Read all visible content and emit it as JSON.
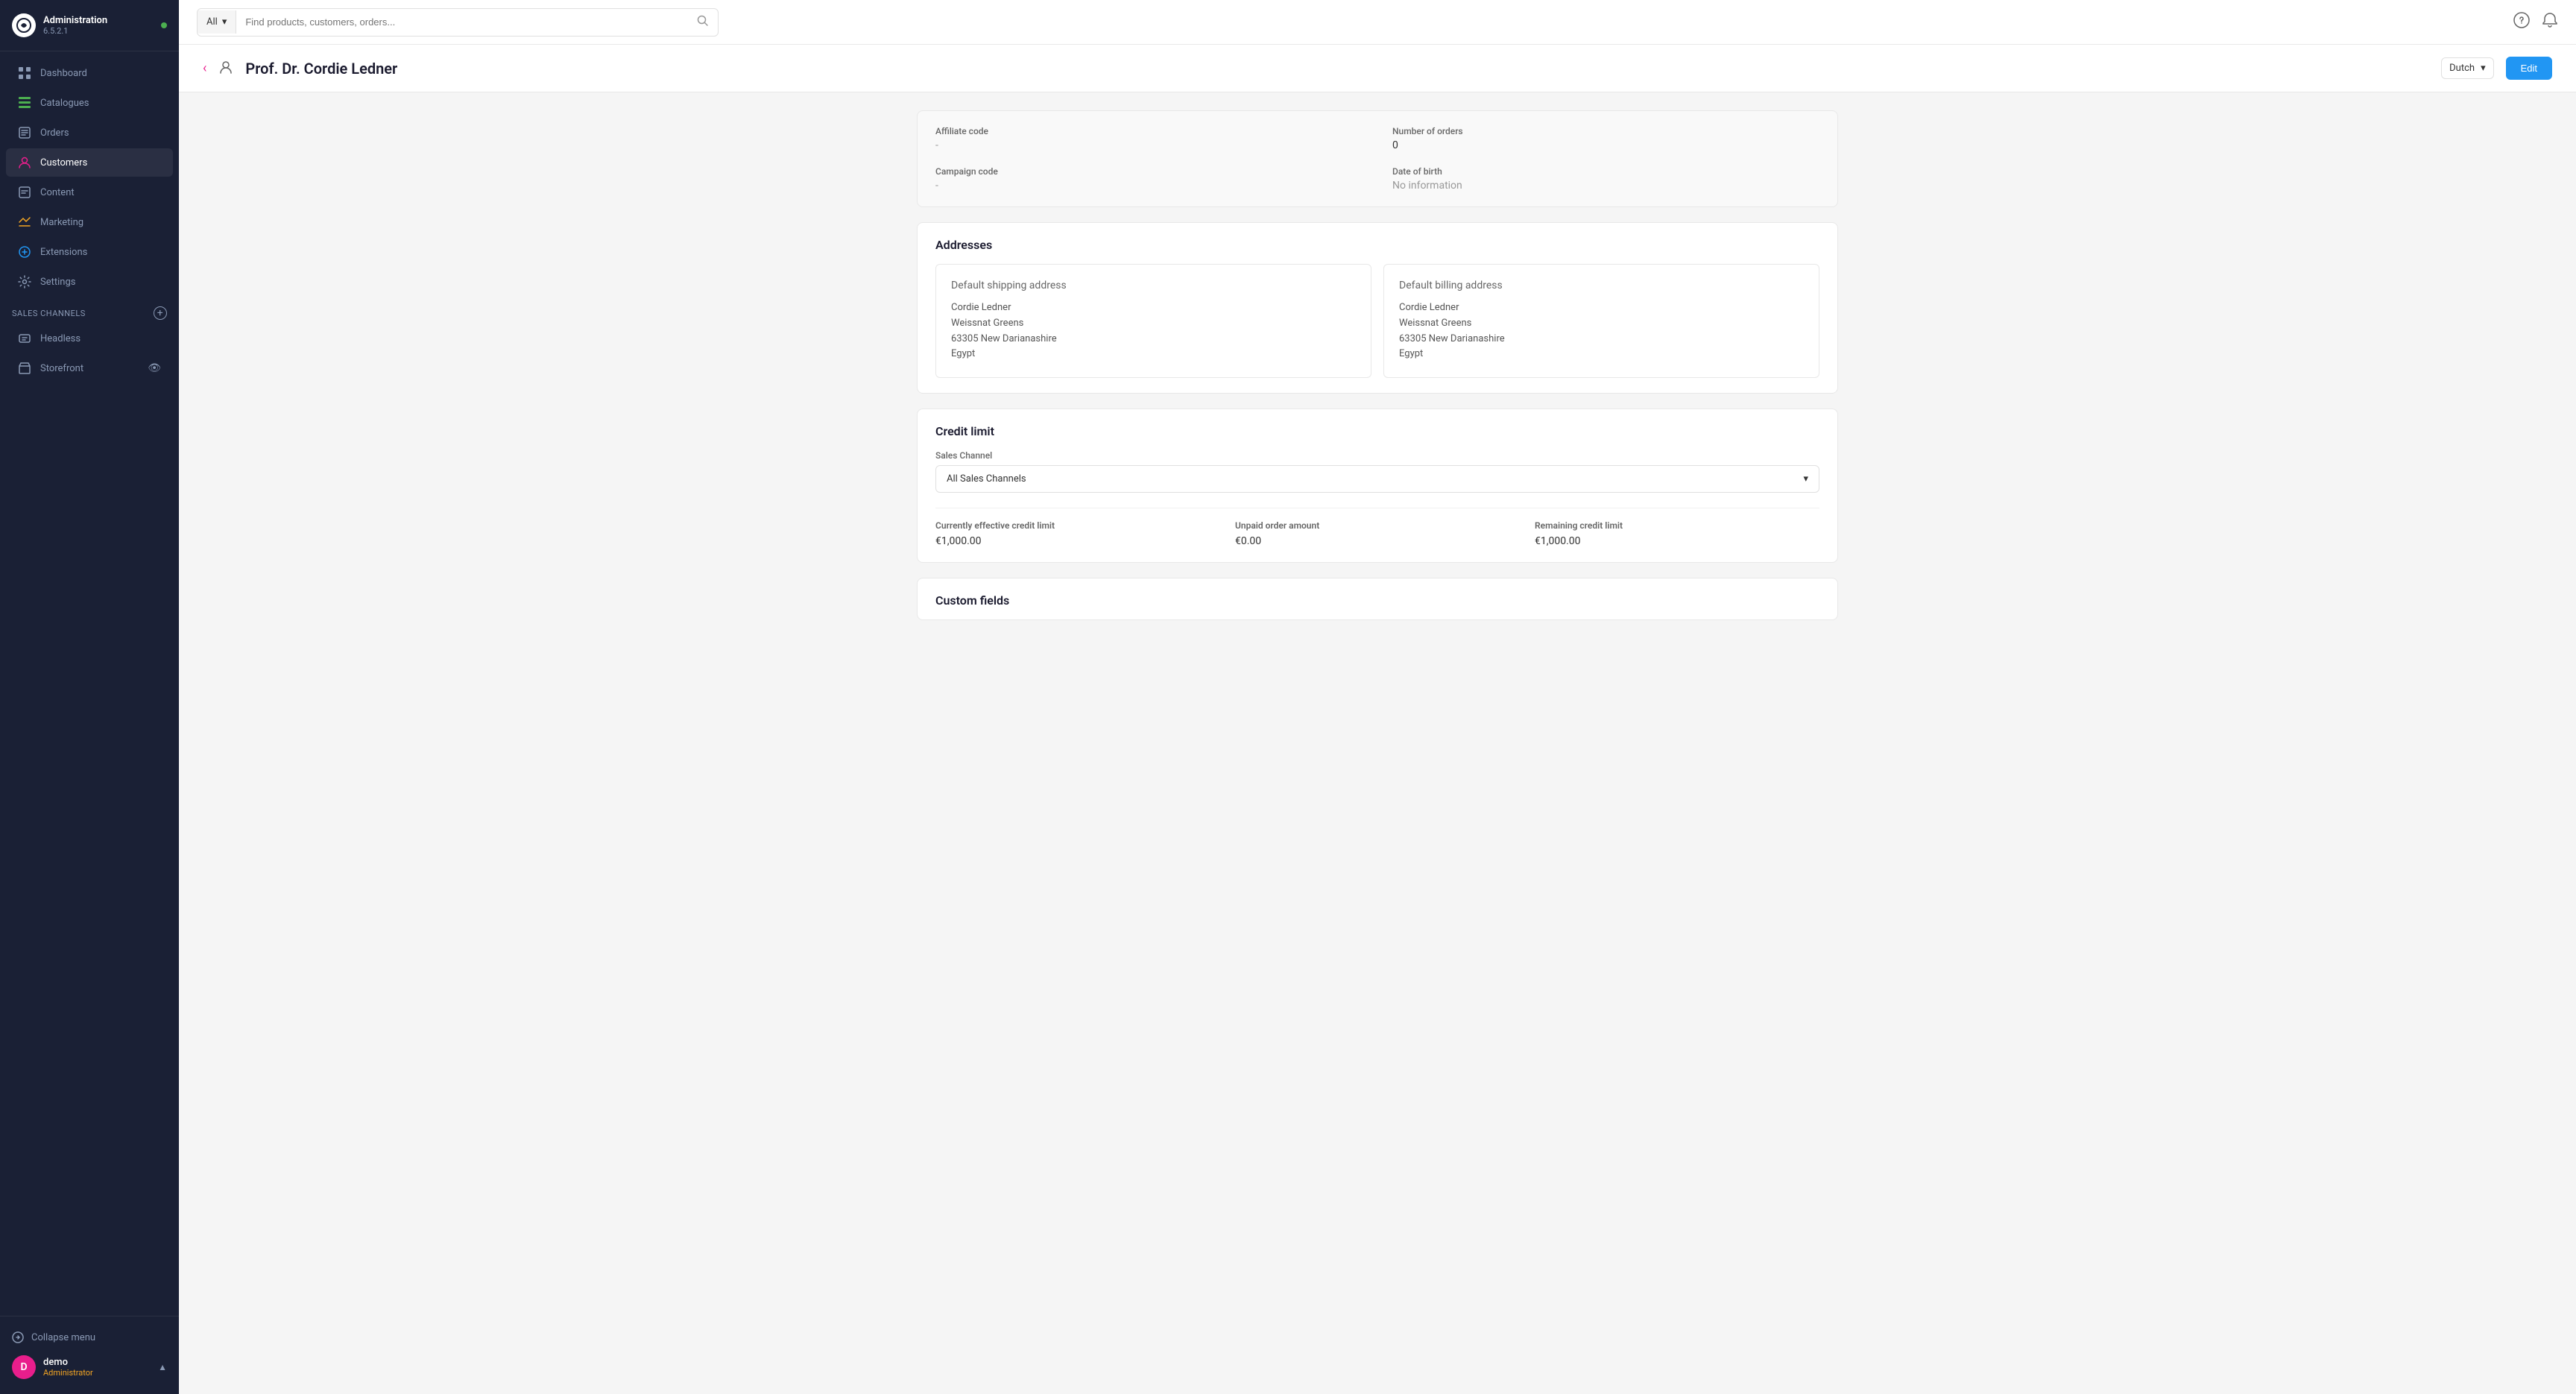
{
  "app": {
    "title": "Administration",
    "version": "6.5.2.1"
  },
  "sidebar": {
    "nav_items": [
      {
        "id": "dashboard",
        "label": "Dashboard",
        "icon": "dashboard"
      },
      {
        "id": "catalogues",
        "label": "Catalogues",
        "icon": "catalogues"
      },
      {
        "id": "orders",
        "label": "Orders",
        "icon": "orders"
      },
      {
        "id": "customers",
        "label": "Customers",
        "icon": "customers",
        "active": true
      },
      {
        "id": "content",
        "label": "Content",
        "icon": "content"
      },
      {
        "id": "marketing",
        "label": "Marketing",
        "icon": "marketing"
      },
      {
        "id": "extensions",
        "label": "Extensions",
        "icon": "extensions"
      },
      {
        "id": "settings",
        "label": "Settings",
        "icon": "settings"
      }
    ],
    "sales_channels_label": "Sales Channels",
    "channels": [
      {
        "id": "headless",
        "label": "Headless",
        "icon": "headless"
      },
      {
        "id": "storefront",
        "label": "Storefront",
        "icon": "storefront"
      }
    ],
    "collapse_label": "Collapse menu",
    "user": {
      "initial": "D",
      "name": "demo",
      "role": "Administrator"
    }
  },
  "topbar": {
    "search_type": "All",
    "search_placeholder": "Find products, customers, orders...",
    "help_icon": "help",
    "notification_icon": "bell"
  },
  "page": {
    "title": "Prof. Dr. Cordie Ledner",
    "language": "Dutch",
    "edit_label": "Edit"
  },
  "customer_info": {
    "affiliate_code_label": "Affiliate code",
    "affiliate_code_value": "-",
    "number_of_orders_label": "Number of orders",
    "number_of_orders_value": "0",
    "campaign_code_label": "Campaign code",
    "campaign_code_value": "-",
    "date_of_birth_label": "Date of birth",
    "date_of_birth_value": "No information"
  },
  "addresses": {
    "section_title": "Addresses",
    "shipping": {
      "title": "Default shipping address",
      "name": "Cordie Ledner",
      "street": "Weissnat Greens",
      "city_zip": "63305 New Darianashire",
      "country": "Egypt"
    },
    "billing": {
      "title": "Default billing address",
      "name": "Cordie Ledner",
      "street": "Weissnat Greens",
      "city_zip": "63305 New Darianashire",
      "country": "Egypt"
    }
  },
  "credit_limit": {
    "section_title": "Credit limit",
    "sales_channel_label": "Sales Channel",
    "sales_channel_value": "All Sales Channels",
    "effective_label": "Currently effective credit limit",
    "effective_value": "€1,000.00",
    "unpaid_label": "Unpaid order amount",
    "unpaid_value": "€0.00",
    "remaining_label": "Remaining credit limit",
    "remaining_value": "€1,000.00"
  },
  "custom_fields": {
    "section_title": "Custom fields"
  }
}
